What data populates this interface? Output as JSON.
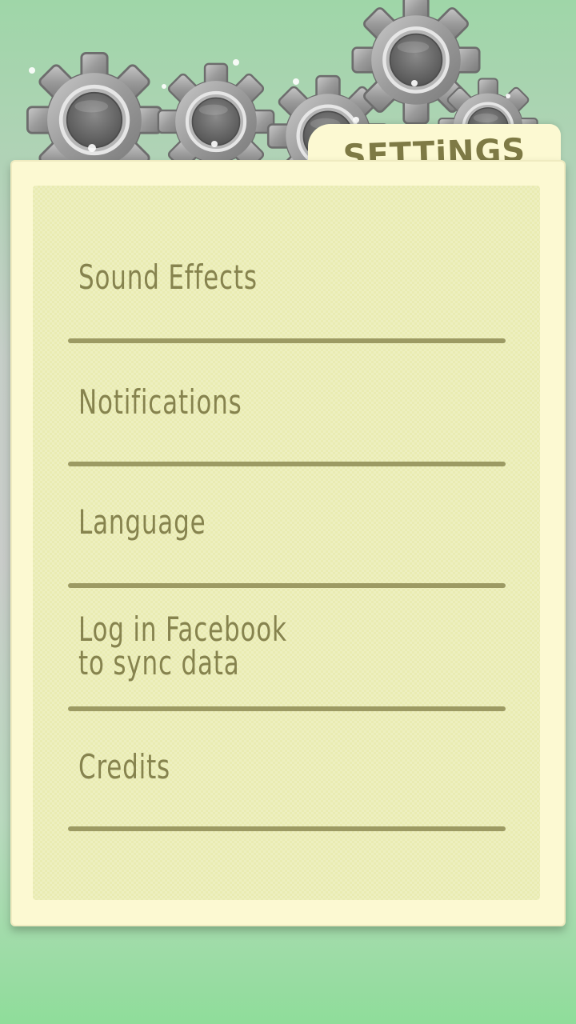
{
  "header": {
    "title": "SETTiNGS"
  },
  "menu": {
    "items": [
      {
        "label": "Sound Effects"
      },
      {
        "label": "Notifications"
      },
      {
        "label": "Language"
      },
      {
        "label": "Log in Facebook\nto sync data"
      },
      {
        "label": "Credits"
      }
    ]
  },
  "colors": {
    "background_top": "#9fd6a8",
    "background_bottom": "#8fdd9a",
    "paper": "#fcf9d2",
    "panel": "#e9ebb2",
    "text": "#86834e",
    "divider": "#9c9a63",
    "gear": "#9b9b9b"
  },
  "icons": {
    "decor": "gear-icon"
  }
}
